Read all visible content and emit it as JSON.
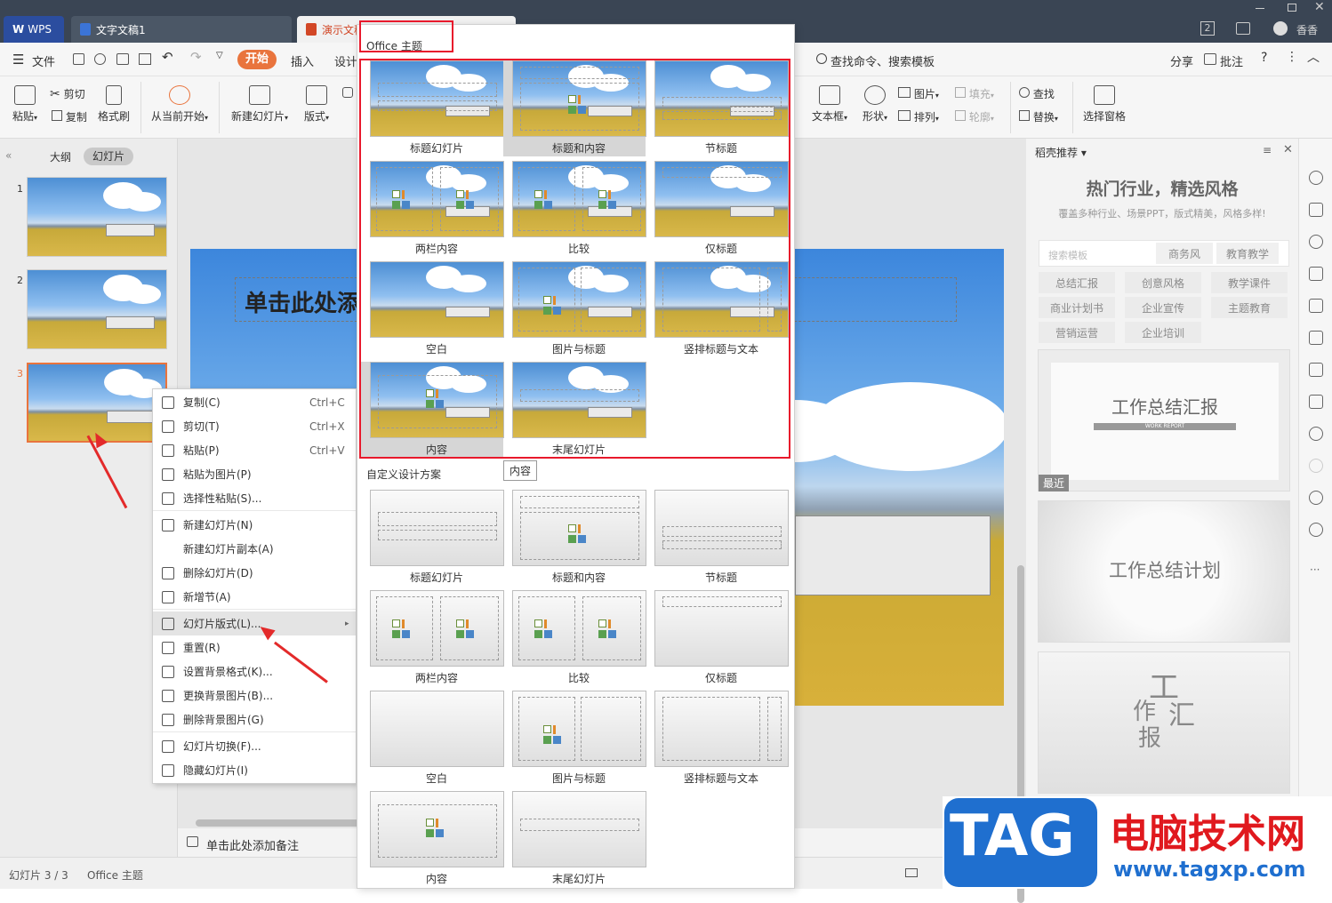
{
  "title_bar": {
    "tabs": [
      "WPS",
      "文字文稿1",
      "演示文稿"
    ],
    "user": "香香",
    "badge": "2"
  },
  "menu": {
    "file": "文件",
    "items": [
      "开始",
      "插入",
      "设计"
    ],
    "search": "查找命令、搜索模板",
    "share": "分享",
    "comment": "批注"
  },
  "ribbon": {
    "paste": "粘贴",
    "cut": "剪切",
    "copy": "复制",
    "format_painter": "格式刷",
    "play_from_current": "从当前开始",
    "new_slide": "新建幻灯片",
    "layout": "版式",
    "textbox": "文本框",
    "shape": "形状",
    "picture": "图片",
    "arrange": "排列",
    "fill": "填充",
    "outline": "轮廓",
    "find": "查找",
    "replace": "替换",
    "selection_pane": "选择窗格"
  },
  "left_panel": {
    "tab_outline": "大纲",
    "tab_slides": "幻灯片",
    "slide_numbers": [
      "1",
      "2",
      "3"
    ]
  },
  "slide": {
    "title_placeholder": "单击此处添"
  },
  "notes": "单击此处添加备注",
  "context_menu": [
    {
      "label": "复制(C)",
      "shortcut": "Ctrl+C"
    },
    {
      "label": "剪切(T)",
      "shortcut": "Ctrl+X"
    },
    {
      "label": "粘贴(P)",
      "shortcut": "Ctrl+V"
    },
    {
      "label": "粘贴为图片(P)",
      "shortcut": ""
    },
    {
      "label": "选择性粘贴(S)...",
      "shortcut": ""
    },
    {
      "label": "新建幻灯片(N)",
      "shortcut": ""
    },
    {
      "label": "新建幻灯片副本(A)",
      "shortcut": ""
    },
    {
      "label": "删除幻灯片(D)",
      "shortcut": ""
    },
    {
      "label": "新增节(A)",
      "shortcut": ""
    },
    {
      "label": "幻灯片版式(L)...",
      "shortcut": ""
    },
    {
      "label": "重置(R)",
      "shortcut": ""
    },
    {
      "label": "设置背景格式(K)...",
      "shortcut": ""
    },
    {
      "label": "更换背景图片(B)...",
      "shortcut": ""
    },
    {
      "label": "删除背景图片(G)",
      "shortcut": ""
    },
    {
      "label": "幻灯片切换(F)...",
      "shortcut": ""
    },
    {
      "label": "隐藏幻灯片(I)",
      "shortcut": ""
    }
  ],
  "layout_panel": {
    "office_theme_heading": "Office 主题",
    "custom_heading": "自定义设计方案",
    "tooltip": "内容",
    "theme_layouts": [
      "标题幻灯片",
      "标题和内容",
      "节标题",
      "两栏内容",
      "比较",
      "仅标题",
      "空白",
      "图片与标题",
      "竖排标题与文本",
      "内容",
      "末尾幻灯片"
    ],
    "custom_layouts": [
      "标题幻灯片",
      "标题和内容",
      "节标题",
      "两栏内容",
      "比较",
      "仅标题",
      "空白",
      "图片与标题",
      "竖排标题与文本",
      "内容",
      "末尾幻灯片"
    ]
  },
  "right_panel": {
    "header": "稻壳推荐",
    "headline": "热门行业，精选风格",
    "subline": "覆盖多种行业、场景PPT，版式精美，风格多样!",
    "search_placeholder": "搜索模板",
    "tags_row1": [
      "商务风",
      "教育教学"
    ],
    "tags": [
      "总结汇报",
      "创意风格",
      "教学课件",
      "商业计划书",
      "企业宣传",
      "主题教育",
      "营销运营",
      "企业培训"
    ],
    "template1_title": "工作总结汇报",
    "template1_sub": "WORK REPORT",
    "template1_badge": "最近",
    "template2_title": "工作总结计划",
    "template3_chars": [
      "工",
      "作",
      "汇",
      "报"
    ]
  },
  "status_bar": {
    "slide_info": "幻灯片 3 / 3",
    "theme": "Office 主题"
  },
  "watermark": {
    "tag": "TAG",
    "cn": "电脑技术网",
    "url": "www.tagxp.com"
  },
  "colors": {
    "accent": "#e8192c",
    "start_button": "#e9743d",
    "titlebar": "#3a4554"
  }
}
